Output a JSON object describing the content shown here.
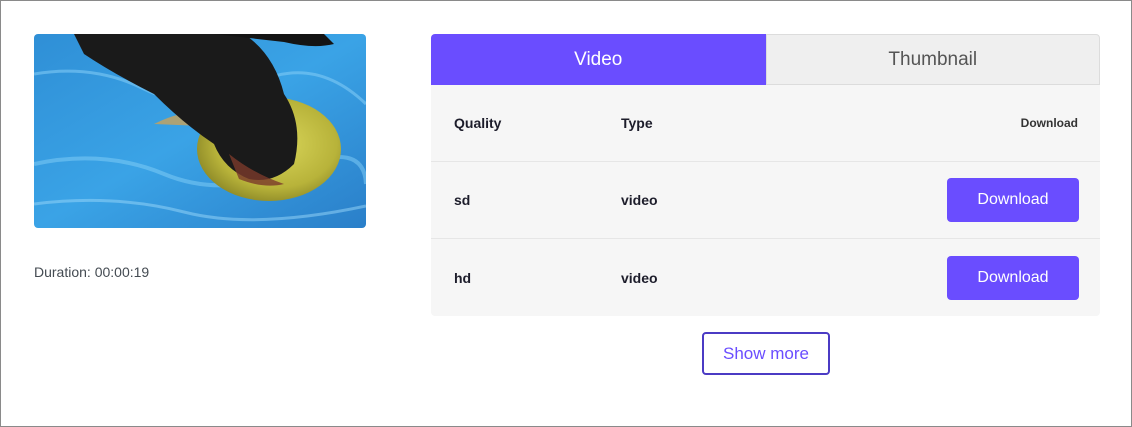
{
  "media": {
    "thumbnail_alt": "video-thumbnail",
    "duration_text": "Duration: 00:00:19"
  },
  "tabs": [
    {
      "label": "Video",
      "active": true
    },
    {
      "label": "Thumbnail",
      "active": false
    }
  ],
  "table": {
    "headers": {
      "quality": "Quality",
      "type": "Type",
      "download": "Download"
    },
    "rows": [
      {
        "quality": "sd",
        "type": "video",
        "action": "Download"
      },
      {
        "quality": "hd",
        "type": "video",
        "action": "Download"
      }
    ]
  },
  "show_more_label": "Show more",
  "colors": {
    "accent": "#6a4dff",
    "tab_inactive_bg": "#efefef",
    "table_bg": "#f6f6f6",
    "show_more_border": "#4b3bc4"
  }
}
